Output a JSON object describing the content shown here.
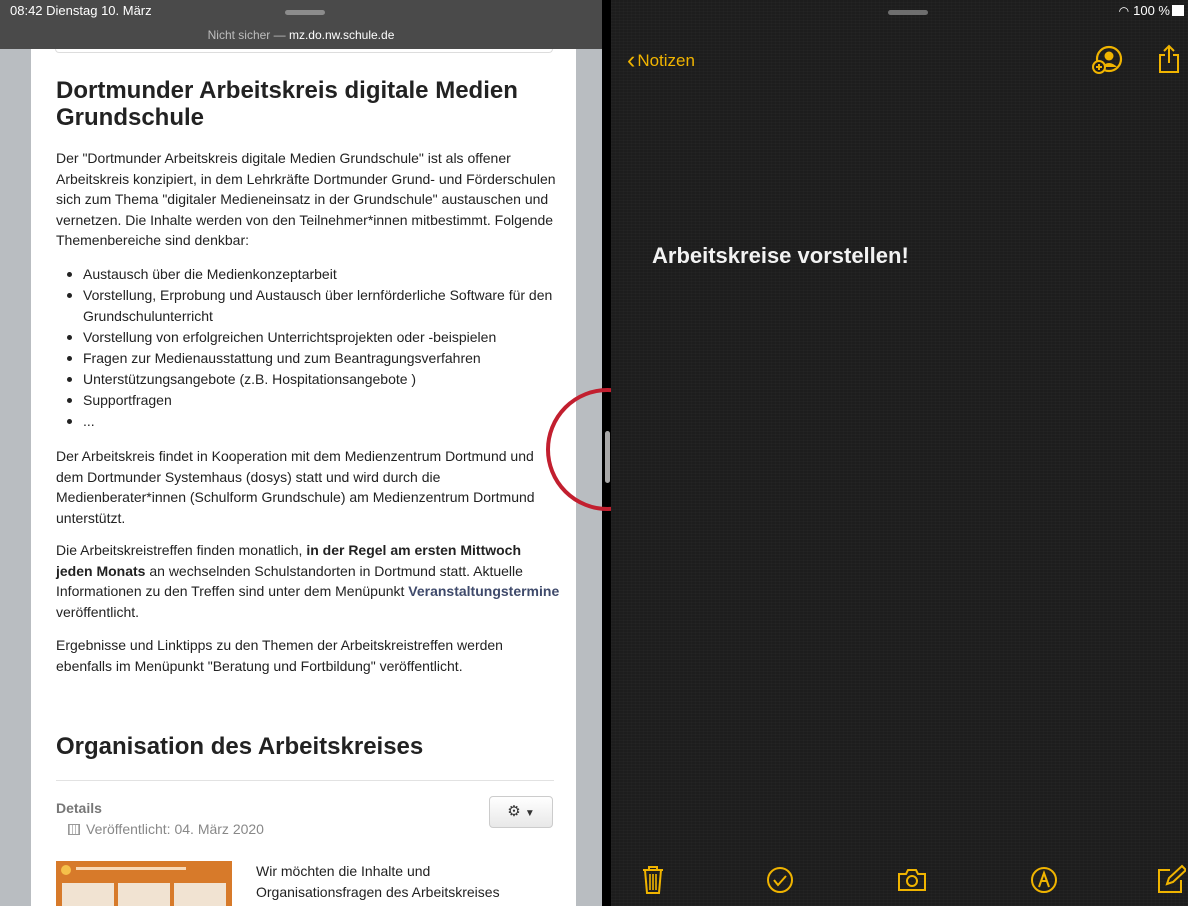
{
  "browser": {
    "status_time": "08:42  Dienstag 10. März",
    "url_prefix": "Nicht sicher — ",
    "url_domain": "mz.do.nw.schule.de"
  },
  "article": {
    "title": "Dortmunder Arbeitskreis digitale Medien Grundschule",
    "intro": "Der \"Dortmunder Arbeitskreis digitale Medien Grundschule\" ist als offener Arbeitskreis konzipiert, in dem Lehrkräfte Dortmunder Grund- und Förderschulen sich zum Thema \"digitaler Medieneinsatz in der Grundschule\" austauschen und vernetzen. Die Inhalte werden von den Teilnehmer*innen mitbestimmt. Folgende Themenbereiche sind denkbar:",
    "bullets": [
      "Austausch über die Medienkonzeptarbeit",
      "Vorstellung, Erprobung und Austausch über lernförderliche Software für den Grundschulunterricht",
      "Vorstellung von erfolgreichen Unterrichtsprojekten oder -beispielen",
      "Fragen zur Medienausstattung und zum Beantragungsverfahren",
      "Unterstützungsangebote (z.B. Hospitationsangebote )",
      "Supportfragen",
      "..."
    ],
    "para2": "Der Arbeitskreis findet in Kooperation mit dem Medienzentrum Dortmund und dem Dortmunder Systemhaus (dosys) statt und wird durch die Medienberater*innen (Schulform Grundschule) am Medienzentrum Dortmund unterstützt.",
    "para3_a": "Die Arbeitskreistreffen finden monatlich, ",
    "para3_bold": "in der Regel am ersten Mittwoch jeden Monats",
    "para3_b": " an wechselnden Schulstandorten in Dortmund statt. Aktuelle Informationen zu den Treffen sind unter dem Menüpunkt ",
    "para3_link": "Veranstaltungstermine",
    "para3_c": " veröffentlicht.",
    "para4": "Ergebnisse und Linktipps zu den Themen der Arbeitskreistreffen werden ebenfalls im Menüpunkt \"Beratung und Fortbildung\" veröffentlicht.",
    "section_title": "Organisation des Arbeitskreises",
    "details_label": "Details",
    "published": "Veröffentlicht: 04. März 2020",
    "section_intro": "Wir möchten die Inhalte und Organisationsfragen des Arbeitskreises"
  },
  "notes": {
    "battery": "100 %",
    "back_label": "Notizen",
    "note_title": "Arbeitskreise vorstellen!",
    "accent_color": "#f0b400",
    "toolbar_icons": [
      "trash-icon",
      "checklist-icon",
      "camera-icon",
      "markup-icon",
      "compose-icon"
    ]
  }
}
